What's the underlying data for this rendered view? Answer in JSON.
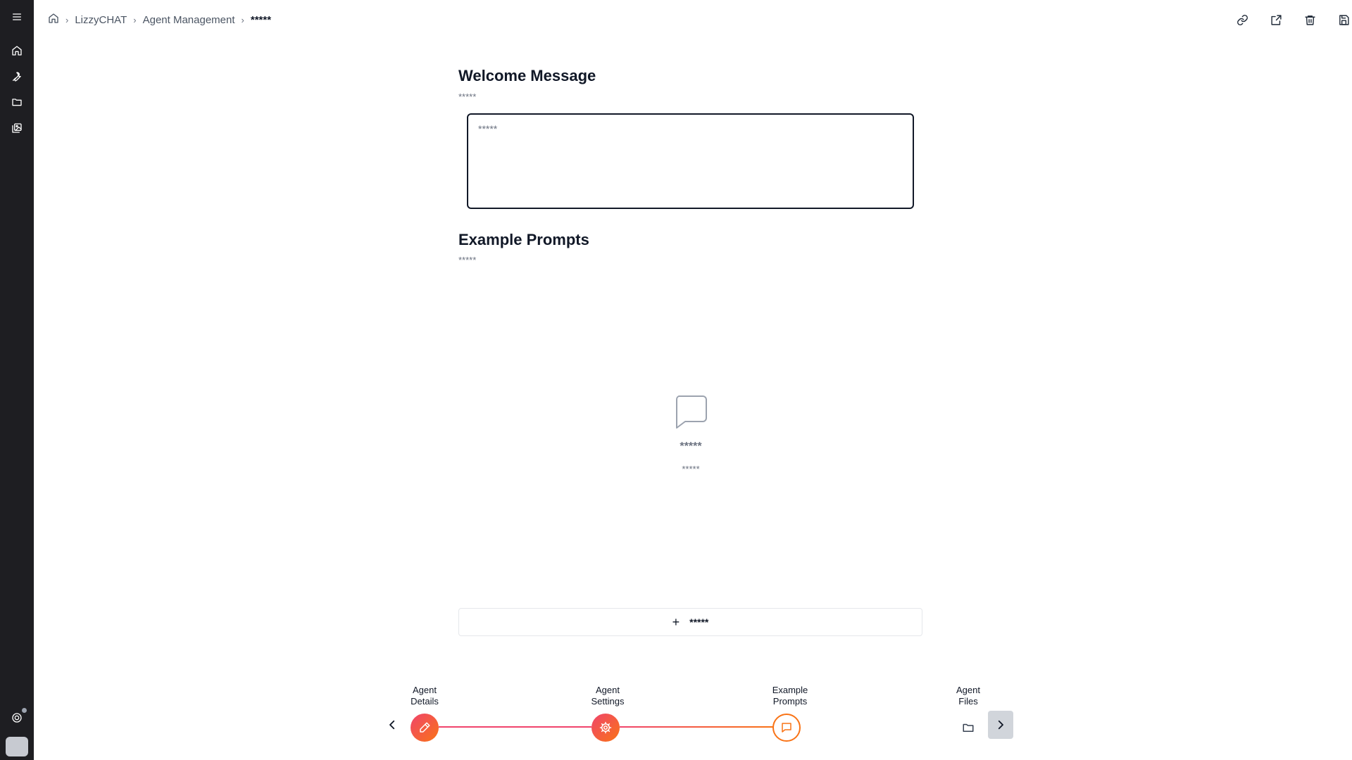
{
  "breadcrumb": {
    "home_icon": "home-icon",
    "items": [
      "LizzyCHAT",
      "Agent Management"
    ],
    "separator": "›",
    "current": "*****"
  },
  "sidebar": {
    "icons": [
      "menu-icon",
      "home-icon",
      "wrench-icon",
      "folder-icon",
      "gallery-icon",
      "support-icon"
    ]
  },
  "top_actions": [
    "link-icon",
    "share-icon",
    "trash-icon",
    "save-icon"
  ],
  "welcome": {
    "title": "Welcome Message",
    "description": "*****",
    "placeholder": "*****"
  },
  "examples": {
    "title": "Example Prompts",
    "description": "*****",
    "empty_title": "*****",
    "empty_subtitle": "*****",
    "add_label": "*****"
  },
  "stepper": {
    "steps": [
      {
        "line1": "Agent",
        "line2": "Details"
      },
      {
        "line1": "Agent",
        "line2": "Settings"
      },
      {
        "line1": "Example",
        "line2": "Prompts"
      },
      {
        "line1": "Agent",
        "line2": "Files"
      }
    ],
    "current_step": 3,
    "colors": {
      "gradient_start": "#f0446c",
      "gradient_end": "#f97316",
      "active_outline": "#f97316"
    }
  }
}
